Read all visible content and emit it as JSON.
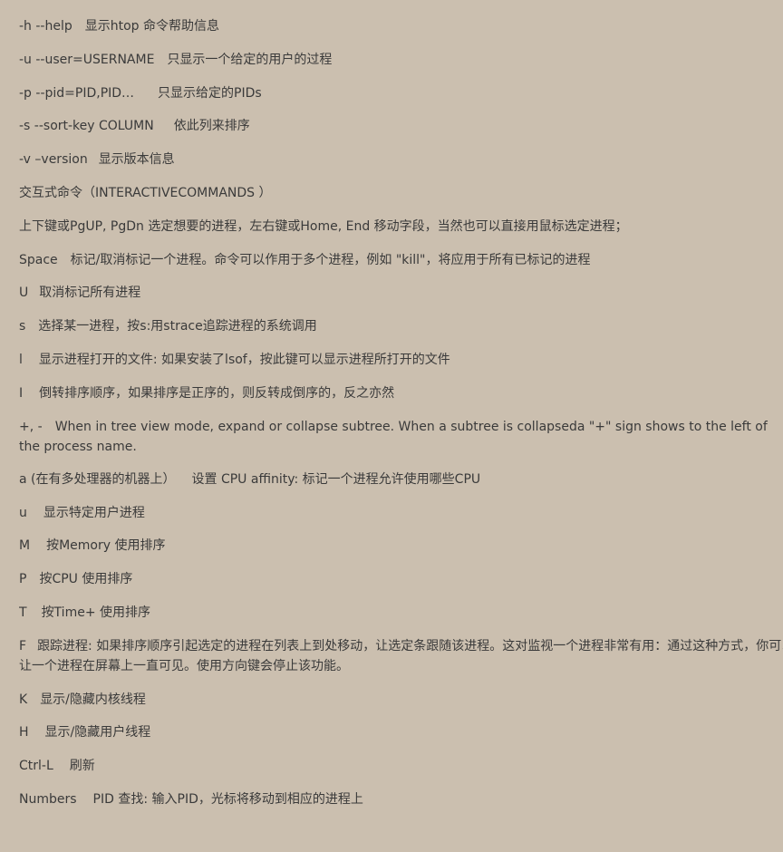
{
  "lines": [
    {
      "key": "-h --help",
      "desc": "显示htop 命令帮助信息",
      "gap": 14
    },
    {
      "key": "-u --user=USERNAME",
      "desc": "只显示一个给定的用户的过程",
      "gap": 14
    },
    {
      "key": "-p --pid=PID,PID…",
      "desc": "只显示给定的PIDs",
      "gap": 26
    },
    {
      "key": "-s --sort-key COLUMN",
      "desc": "依此列来排序",
      "gap": 22
    },
    {
      "key": "-v –version",
      "desc": "显示版本信息",
      "gap": 12
    },
    {
      "key": "交互式命令（INTERACTIVECOMMANDS ）",
      "desc": "",
      "gap": 0
    },
    {
      "key": "上下键或PgUP, PgDn 选定想要的进程，左右键或Home, End 移动字段，当然也可以直接用鼠标选定进程；",
      "desc": "",
      "gap": 0
    },
    {
      "key": "Space",
      "desc": "标记/取消标记一个进程。命令可以作用于多个进程，例如 \"kill\"，将应用于所有已标记的进程",
      "gap": 14
    },
    {
      "key": "U",
      "desc": "取消标记所有进程",
      "gap": 12
    },
    {
      "key": "s",
      "desc": "选择某一进程，按s:用strace追踪进程的系统调用",
      "gap": 14
    },
    {
      "key": "l",
      "desc": "显示进程打开的文件: 如果安装了lsof，按此键可以显示进程所打开的文件",
      "gap": 18
    },
    {
      "key": "I",
      "desc": "倒转排序顺序，如果排序是正序的，则反转成倒序的，反之亦然",
      "gap": 18
    },
    {
      "key": "+, -",
      "desc": "When in tree view mode, expand or collapse subtree. When a subtree is collapseda \"+\" sign shows to the left of the process name.",
      "gap": 14,
      "wrap": true
    },
    {
      "key": "a (在有多处理器的机器上）",
      "desc": "设置 CPU affinity: 标记一个进程允许使用哪些CPU",
      "gap": 18
    },
    {
      "key": "u",
      "desc": "显示特定用户进程",
      "gap": 18
    },
    {
      "key": "M",
      "desc": "按Memory 使用排序",
      "gap": 18
    },
    {
      "key": "P",
      "desc": "按CPU 使用排序",
      "gap": 14
    },
    {
      "key": "T",
      "desc": "按Time+ 使用排序",
      "gap": 16
    },
    {
      "key": "F",
      "desc": "跟踪进程: 如果排序顺序引起选定的进程在列表上到处移动，让选定条跟随该进程。这对监视一个进程非常有用：通过这种方式，你可以",
      "desc2": "让一个进程在屏幕上一直可见。使用方向键会停止该功能。",
      "gap": 12,
      "clip": true
    },
    {
      "key": "K",
      "desc": "显示/隐藏内核线程",
      "gap": 14
    },
    {
      "key": "H",
      "desc": "显示/隐藏用户线程",
      "gap": 18
    },
    {
      "key": "Ctrl-L",
      "desc": "刷新",
      "gap": 18
    },
    {
      "key": "Numbers",
      "desc": "PID 查找: 输入PID，光标将移动到相应的进程上",
      "gap": 18
    }
  ]
}
